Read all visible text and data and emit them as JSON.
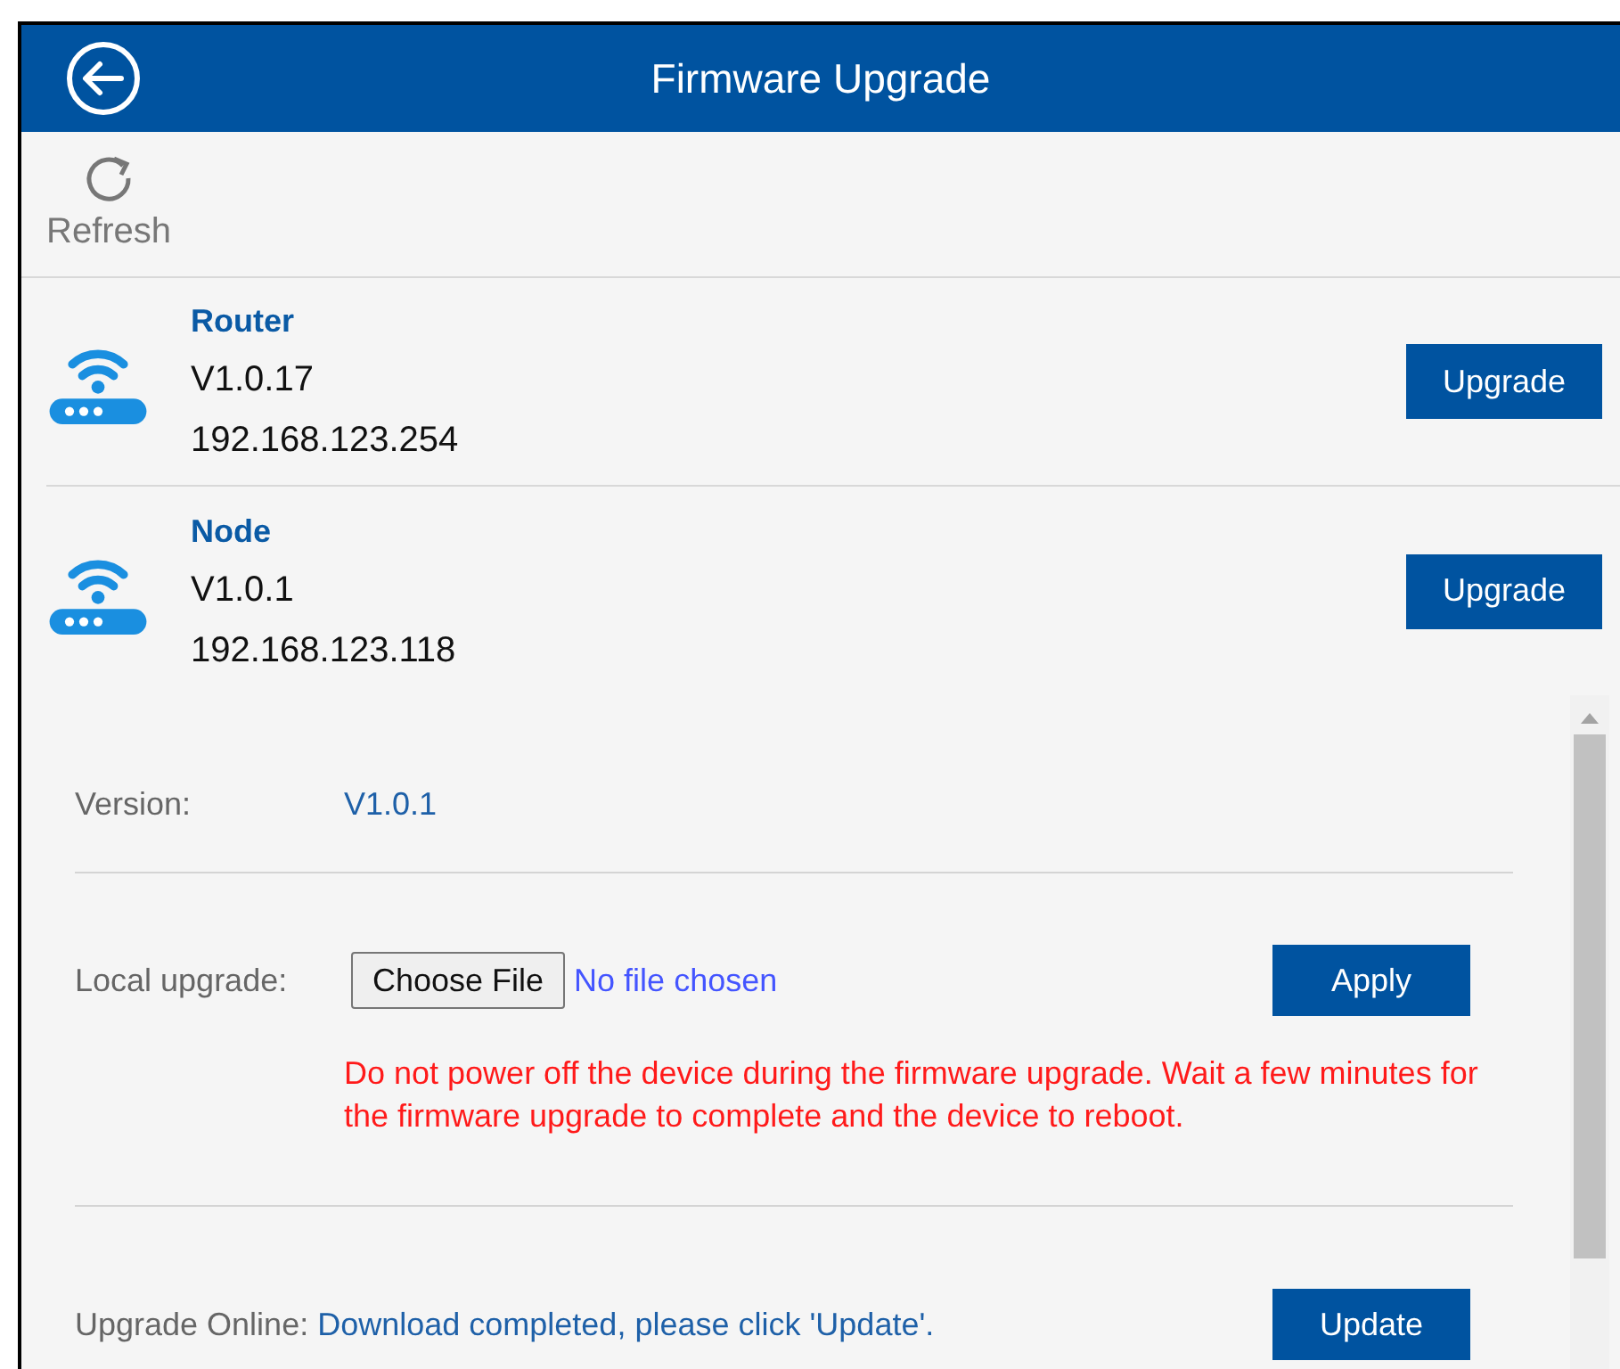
{
  "header": {
    "title": "Firmware Upgrade"
  },
  "toolbar": {
    "refresh_label": "Refresh"
  },
  "devices": [
    {
      "name": "Router",
      "version": "V1.0.17",
      "ip": "192.168.123.254",
      "button": "Upgrade"
    },
    {
      "name": "Node",
      "version": "V1.0.1",
      "ip": "192.168.123.118",
      "button": "Upgrade"
    }
  ],
  "details": {
    "version_label": "Version:",
    "version_value": "V1.0.1",
    "local_label": "Local upgrade:",
    "choose_file": "Choose File",
    "file_status": "No file chosen",
    "apply": "Apply",
    "warning": "Do not power off the device during the firmware upgrade. Wait a few minutes for the firmware upgrade to complete and the device to reboot.",
    "online_label": "Upgrade Online:",
    "online_status": "Download completed, please click 'Update'.",
    "update": "Update"
  }
}
